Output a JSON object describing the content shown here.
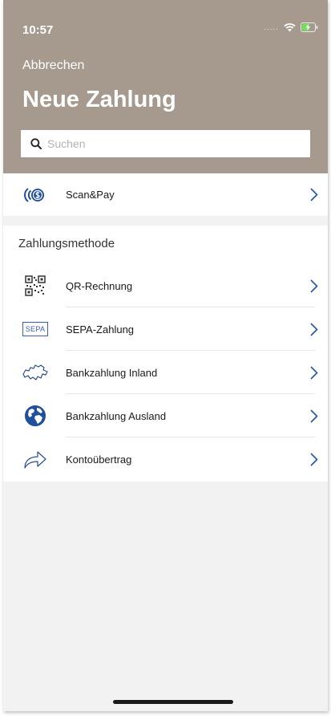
{
  "status_bar": {
    "time": "10:57",
    "signal": "....."
  },
  "header": {
    "cancel_label": "Abbrechen",
    "title": "Neue Zahlung",
    "search": {
      "placeholder": "Suchen",
      "value": ""
    },
    "background_color": "#a59a8d"
  },
  "scan_pay": {
    "label": "Scan&Pay",
    "icon": "scan-pay-coin-icon"
  },
  "methods": {
    "section_title": "Zahlungsmethode",
    "items": [
      {
        "label": "QR-Rechnung",
        "icon": "qr-code-icon"
      },
      {
        "label": "SEPA-Zahlung",
        "icon": "sepa-icon",
        "icon_text": "SEPA"
      },
      {
        "label": "Bankzahlung Inland",
        "icon": "switzerland-map-icon"
      },
      {
        "label": "Bankzahlung Ausland",
        "icon": "globe-icon"
      },
      {
        "label": "Kontoübertrag",
        "icon": "transfer-arrow-icon"
      }
    ]
  },
  "colors": {
    "accent_blue": "#1f4f9e",
    "chevron": "#2c5ea8"
  }
}
